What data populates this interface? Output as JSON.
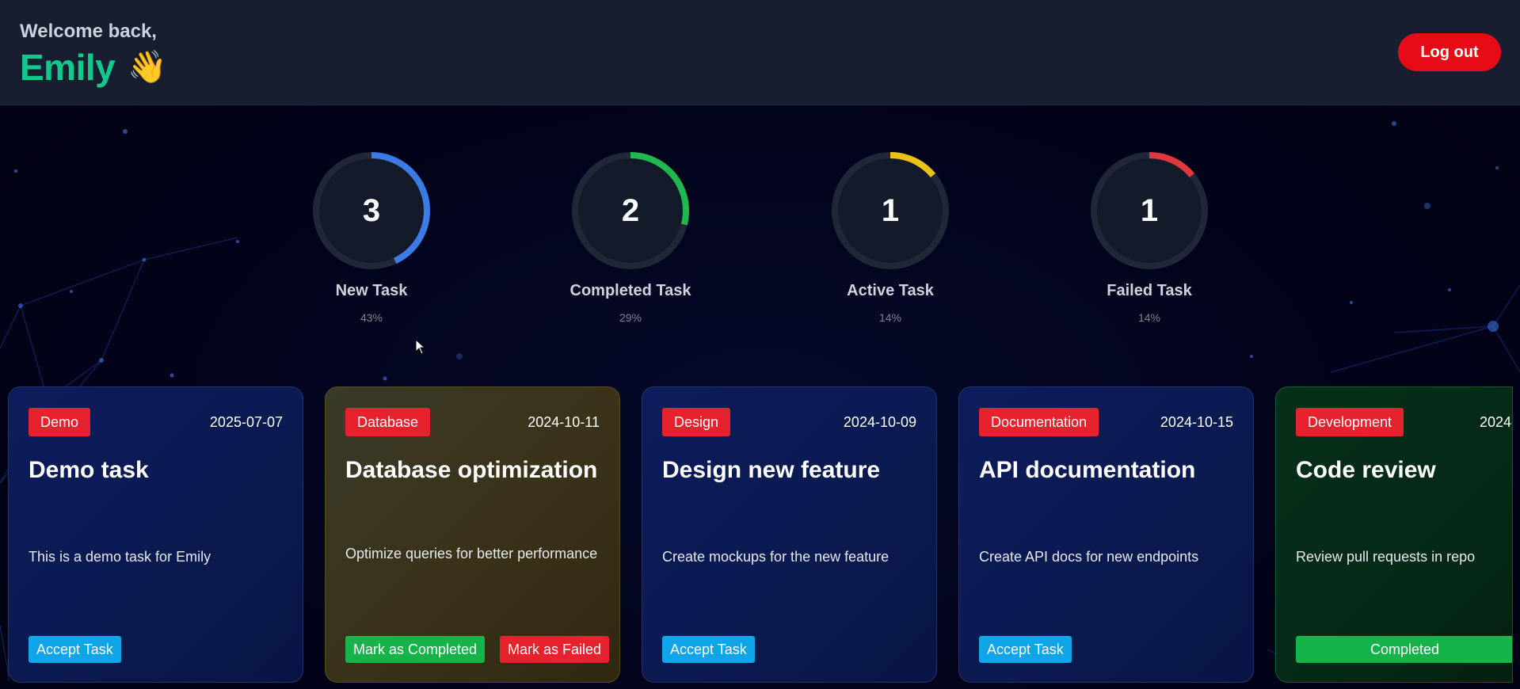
{
  "header": {
    "welcome_text": "Welcome back,",
    "user_name": "Emily",
    "wave_emoji": "👋",
    "logout_label": "Log out"
  },
  "stats": [
    {
      "count": "3",
      "label": "New Task",
      "percent_text": "43%",
      "fraction": 0.43,
      "color": "#3b7be6"
    },
    {
      "count": "2",
      "label": "Completed Task",
      "percent_text": "29%",
      "fraction": 0.29,
      "color": "#1fb94f"
    },
    {
      "count": "1",
      "label": "Active Task",
      "percent_text": "14%",
      "fraction": 0.14,
      "color": "#e8c313"
    },
    {
      "count": "1",
      "label": "Failed Task",
      "percent_text": "14%",
      "fraction": 0.14,
      "color": "#e2373c"
    }
  ],
  "tasks": [
    {
      "category": "Demo",
      "date": "2025-07-07",
      "title": "Demo task",
      "description": "This is a demo task for Emily",
      "actions": [
        "Accept Task"
      ]
    },
    {
      "category": "Database",
      "date": "2024-10-11",
      "title": "Database optimization",
      "description": "Optimize queries for better performance",
      "actions": [
        "Mark as Completed",
        "Mark as Failed"
      ]
    },
    {
      "category": "Design",
      "date": "2024-10-09",
      "title": "Design new feature",
      "description": "Create mockups for the new feature",
      "actions": [
        "Accept Task"
      ]
    },
    {
      "category": "Documentation",
      "date": "2024-10-15",
      "title": "API documentation",
      "description": "Create API docs for new endpoints",
      "actions": [
        "Accept Task"
      ]
    },
    {
      "category": "Development",
      "date": "2024-",
      "title": "Code review",
      "description": "Review pull requests in repo",
      "actions": [
        "Completed"
      ]
    }
  ],
  "colors": {
    "brand_green": "#10c98a",
    "logout_red": "#e60b14",
    "badge_red": "#e5222d",
    "accept_blue": "#0ea5e9",
    "success_green": "#16b34a"
  }
}
